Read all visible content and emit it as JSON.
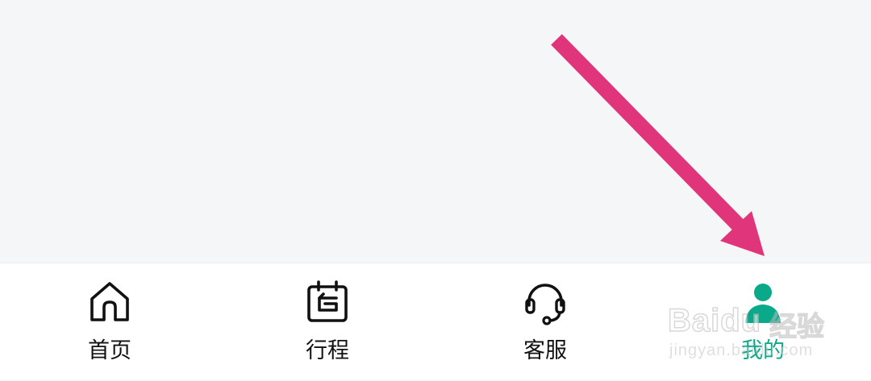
{
  "tab_bar": {
    "items": [
      {
        "label": "首页",
        "icon": "home-icon",
        "active": false
      },
      {
        "label": "行程",
        "icon": "itinerary-icon",
        "active": false
      },
      {
        "label": "客服",
        "icon": "headset-icon",
        "active": false
      },
      {
        "label": "我的",
        "icon": "user-icon",
        "active": true
      }
    ]
  },
  "annotation": {
    "color": "#e0357a"
  },
  "theme": {
    "accent": "#0aa98a",
    "text": "#111111",
    "background": "#f5f6f8"
  },
  "watermark": {
    "brand": "Baidu",
    "cn": "经验",
    "url": "jingyan.baidu.com"
  }
}
